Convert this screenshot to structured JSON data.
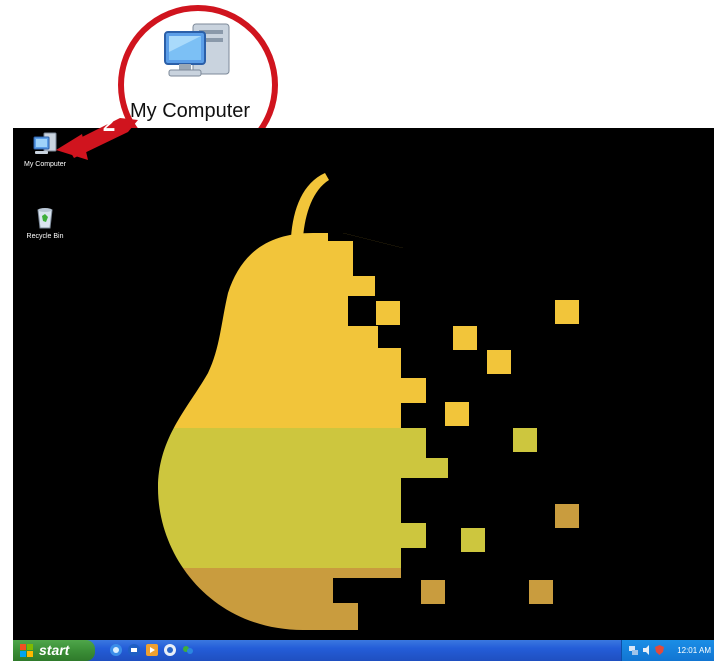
{
  "callout": {
    "step_number": "2",
    "label": "My Computer",
    "accent": "#d0141e"
  },
  "desktop": {
    "background": "#000000",
    "icons": [
      {
        "label": "My Computer",
        "icon": "my-computer-icon"
      },
      {
        "label": "Recycle Bin",
        "icon": "recycle-bin-icon"
      }
    ],
    "wallpaper": {
      "subject": "pixelated pear",
      "colors": [
        "#f2c53a",
        "#cdc63e",
        "#c99c3e"
      ]
    }
  },
  "taskbar": {
    "start_label": "start",
    "quick_launch": [
      "internet-explorer-icon",
      "outlook-express-icon",
      "media-player-icon",
      "show-desktop-icon",
      "messenger-icon"
    ],
    "tray_icons": [
      "network-icon",
      "volume-icon",
      "security-icon"
    ],
    "clock": "12:01 AM",
    "colors": {
      "bar": "#245dd8",
      "start": "#3b8f37",
      "tray": "#1275d2"
    }
  }
}
